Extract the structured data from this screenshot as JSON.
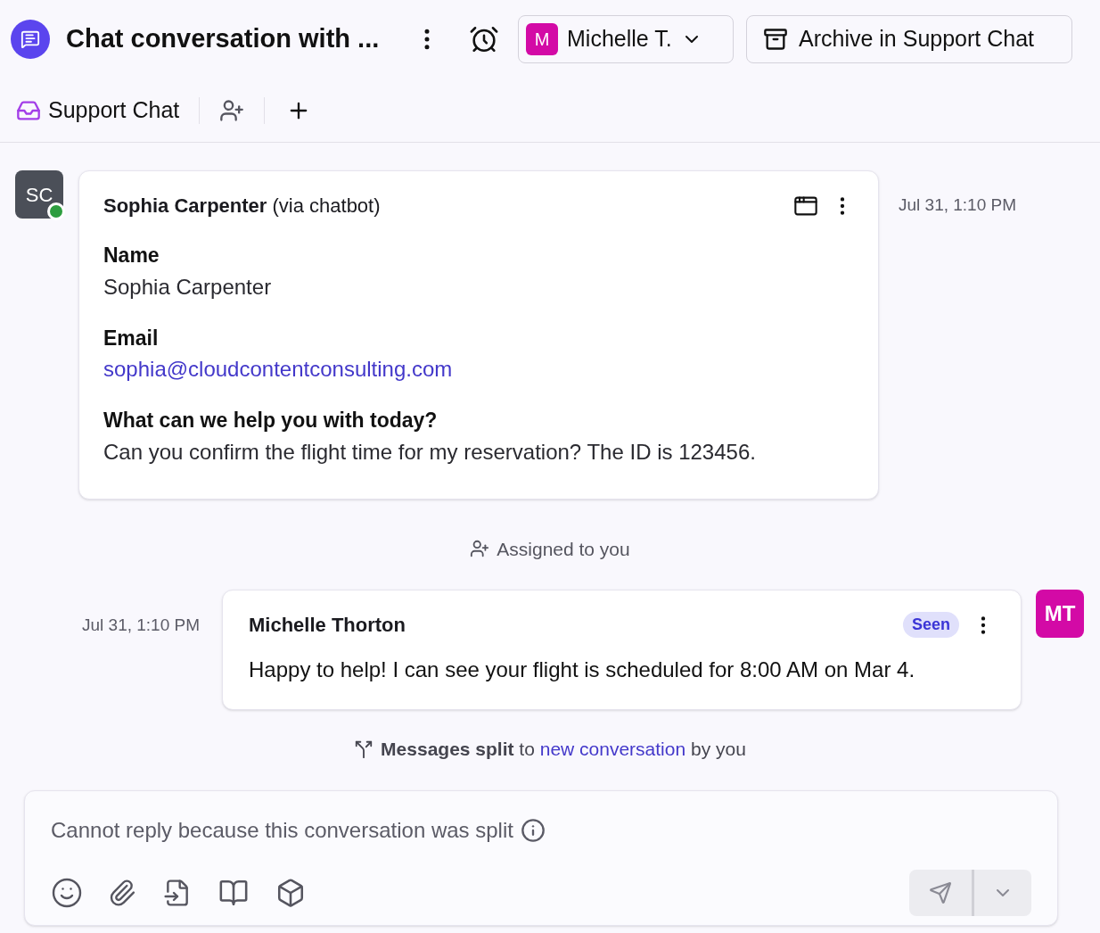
{
  "header": {
    "title": "Chat conversation with ...",
    "assignee": {
      "initial": "M",
      "name": "Michelle T.",
      "color": "#d30aa6"
    },
    "archive_button": "Archive in Support Chat"
  },
  "inbox": {
    "label": "Support Chat"
  },
  "timeline": [
    {
      "kind": "form",
      "avatar": "SC",
      "online": true,
      "sender": "Sophia Carpenter",
      "via": "(via chatbot)",
      "time": "Jul 31, 1:10 PM",
      "fields": [
        {
          "label": "Name",
          "value": "Sophia Carpenter",
          "kind": "text"
        },
        {
          "label": "Email",
          "value": "sophia@cloudcontentconsulting.com",
          "kind": "link"
        },
        {
          "label": "What can we help you with today?",
          "value": "Can you confirm the flight time for my reservation? The ID is 123456.",
          "kind": "text"
        }
      ]
    },
    {
      "kind": "assigned",
      "text": "Assigned to you"
    },
    {
      "kind": "reply",
      "avatar": "MT",
      "sender": "Michelle Thorton",
      "status": "Seen",
      "time": "Jul 31, 1:10 PM",
      "body": "Happy to help! I can see your flight is scheduled for 8:00 AM on Mar 4."
    },
    {
      "kind": "split",
      "before": "**Messages split** to",
      "link": "new conversation",
      "after": "by you"
    }
  ],
  "composer": {
    "notice": "Cannot reply because this conversation was split",
    "send_disabled": true
  }
}
